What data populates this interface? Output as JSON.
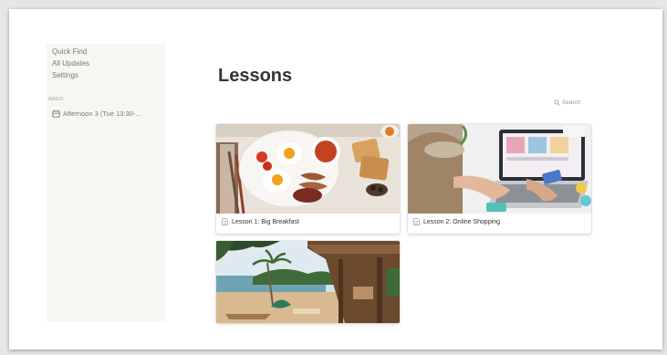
{
  "sidebar": {
    "items": [
      {
        "label": "Quick Find"
      },
      {
        "label": "All Updates"
      },
      {
        "label": "Settings"
      }
    ],
    "section_label": "ARED",
    "page_label": "Afternoon 3 (Tue 13:30-..."
  },
  "main": {
    "title": "Lessons",
    "search_label": "Search",
    "cards": [
      {
        "label": "Lesson 1: Big Breakfast",
        "icon": "page-icon"
      },
      {
        "label": "Lesson 2: Online Shopping",
        "icon": "page-icon"
      },
      {
        "label": "",
        "icon": ""
      }
    ]
  },
  "colors": {
    "sidebar_bg": "#f7f6f3",
    "text": "#37352f",
    "muted": "#9b9a97"
  }
}
